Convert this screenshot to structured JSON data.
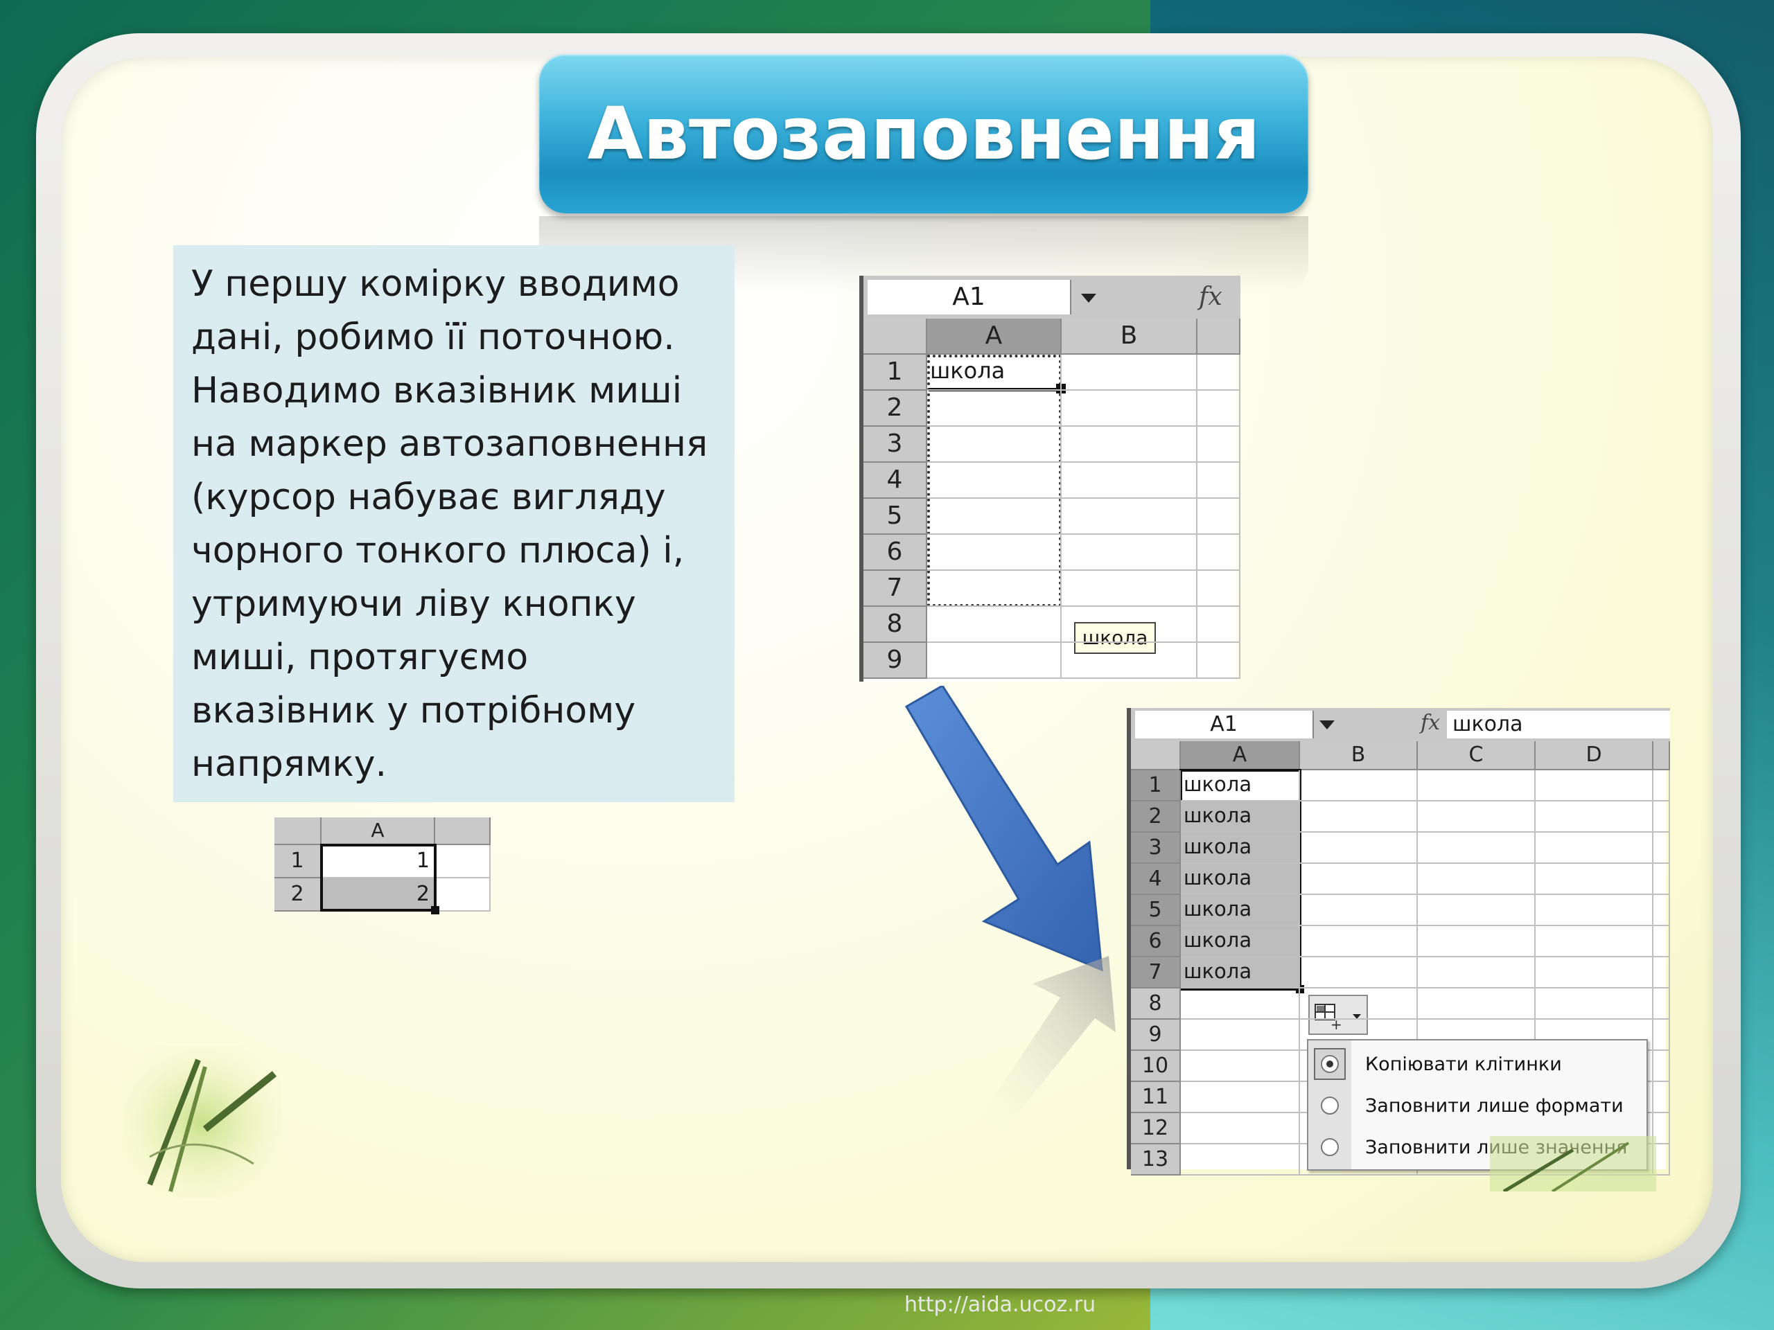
{
  "slide": {
    "title": "Автозаповнення",
    "body_text": "У першу комірку вводимо дані, робимо її поточною. Наводимо вказівник миші на маркер автозаповнення (курсор набуває вигляду чорного тонкого плюса) і, утримуючи ліву кнопку миші, протягуємо вказівник у потрібному напрямку.",
    "footer_url": "http://aida.ucoz.ru"
  },
  "small_table": {
    "col_header": "A",
    "rows": [
      {
        "num": "1",
        "value": "1"
      },
      {
        "num": "2",
        "value": "2"
      }
    ]
  },
  "sheet1": {
    "name_box": "A1",
    "fx_label": "fx",
    "col_headers": [
      "A",
      "B"
    ],
    "row_numbers": [
      "1",
      "2",
      "3",
      "4",
      "5",
      "6",
      "7",
      "8",
      "9"
    ],
    "cell_a1": "школа",
    "tooltip": "школа"
  },
  "sheet2": {
    "name_box": "A1",
    "fx_label": "fx",
    "formula_value": "школа",
    "col_headers": [
      "A",
      "B",
      "C",
      "D"
    ],
    "row_numbers": [
      "1",
      "2",
      "3",
      "4",
      "5",
      "6",
      "7",
      "8",
      "9",
      "10",
      "11",
      "12",
      "13"
    ],
    "filled_values": [
      "школа",
      "школа",
      "школа",
      "школа",
      "школа",
      "школа",
      "школа"
    ],
    "autofill_options_icon": "autofill-options-icon",
    "menu_options": [
      {
        "label": "Копіювати клітинки",
        "selected": true
      },
      {
        "label": "Заповнити лише формати",
        "selected": false
      },
      {
        "label": "Заповнити лише значення",
        "selected": false
      }
    ]
  },
  "colors": {
    "title_blue": "#1a8fc0",
    "arrow_blue": "#3f74c6",
    "text_box_bg": "#dbecf1"
  }
}
